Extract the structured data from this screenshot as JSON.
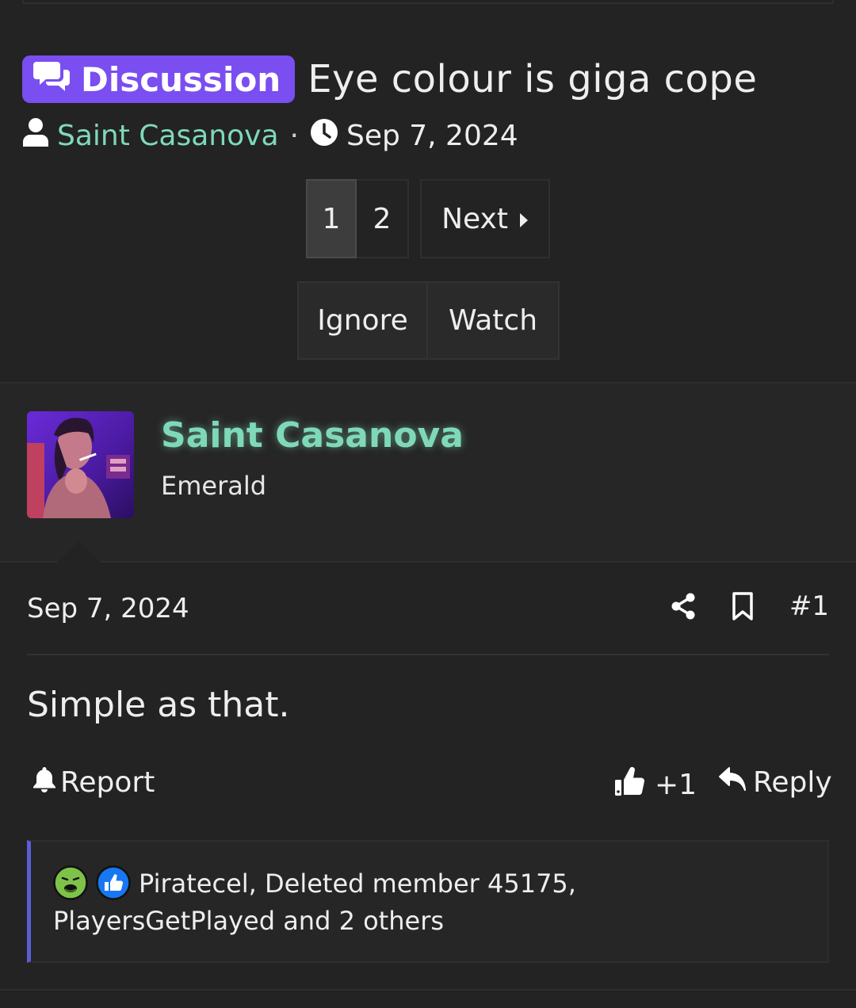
{
  "thread": {
    "prefix": "Discussion",
    "title": "Eye colour is giga cope",
    "author": "Saint Casanova",
    "separator": "·",
    "date": "Sep 7, 2024"
  },
  "pagination": {
    "current": "1",
    "page2": "2",
    "next_label": "Next"
  },
  "thread_actions": {
    "ignore": "Ignore",
    "watch": "Watch"
  },
  "post": {
    "username": "Saint Casanova",
    "user_title": "Emerald",
    "date": "Sep 7, 2024",
    "number": "#1",
    "body": "Simple as that.",
    "report": "Report",
    "like_count": "+1",
    "reply": "Reply",
    "reactions_text": "Piratecel, Deleted member 45175, PlayersGetPlayed and 2 others"
  },
  "colors": {
    "prefix_bg": "#7a4ef0",
    "username": "#7fd9b8",
    "reactions_accent": "#5a5fd6"
  }
}
